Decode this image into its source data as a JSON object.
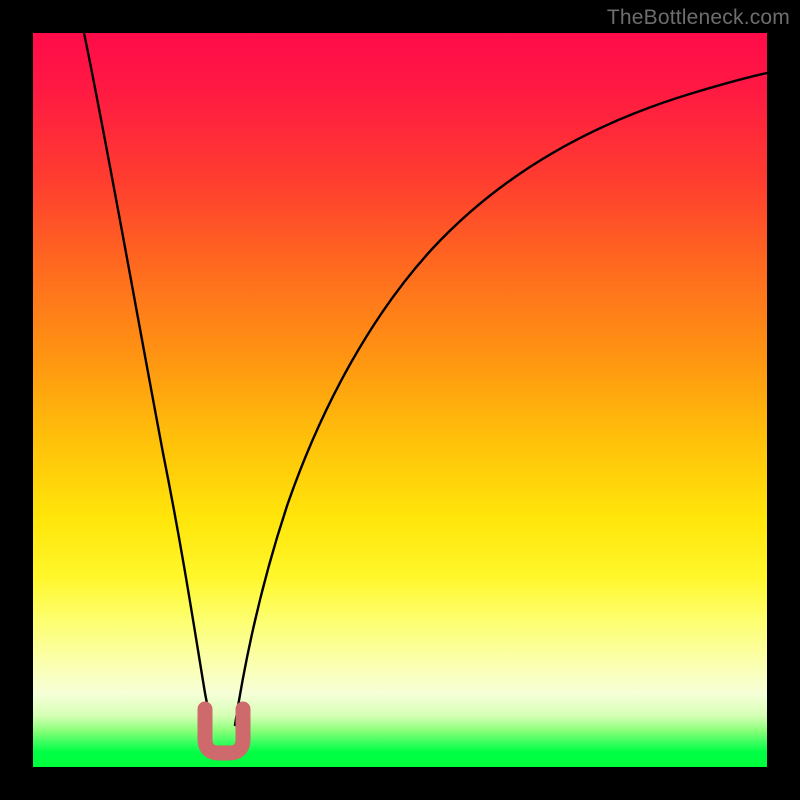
{
  "watermark": "TheBottleneck.com",
  "chart_data": {
    "type": "line",
    "title": "",
    "xlabel": "",
    "ylabel": "",
    "xlim": [
      0,
      100
    ],
    "ylim": [
      0,
      100
    ],
    "grid": false,
    "legend": false,
    "annotations": [
      {
        "name": "trough-marker",
        "shape": "U",
        "color": "#d46a6a",
        "x_center": 25.5,
        "y": 5,
        "width_pct": 5
      }
    ],
    "series": [
      {
        "name": "left-branch",
        "x": [
          7,
          9,
          11,
          13,
          15,
          17,
          19,
          20,
          21,
          22,
          23,
          24
        ],
        "y": [
          100,
          88,
          76,
          64,
          53,
          42,
          31,
          25,
          20,
          15,
          10,
          6
        ]
      },
      {
        "name": "right-branch",
        "x": [
          27,
          28,
          29,
          30,
          32,
          34,
          37,
          40,
          44,
          48,
          53,
          58,
          64,
          70,
          77,
          84,
          91,
          98,
          100
        ],
        "y": [
          6,
          10,
          14,
          18,
          25,
          31,
          39,
          46,
          53,
          59,
          65,
          70,
          74,
          78,
          81,
          84,
          86.5,
          88.5,
          89
        ]
      }
    ]
  }
}
